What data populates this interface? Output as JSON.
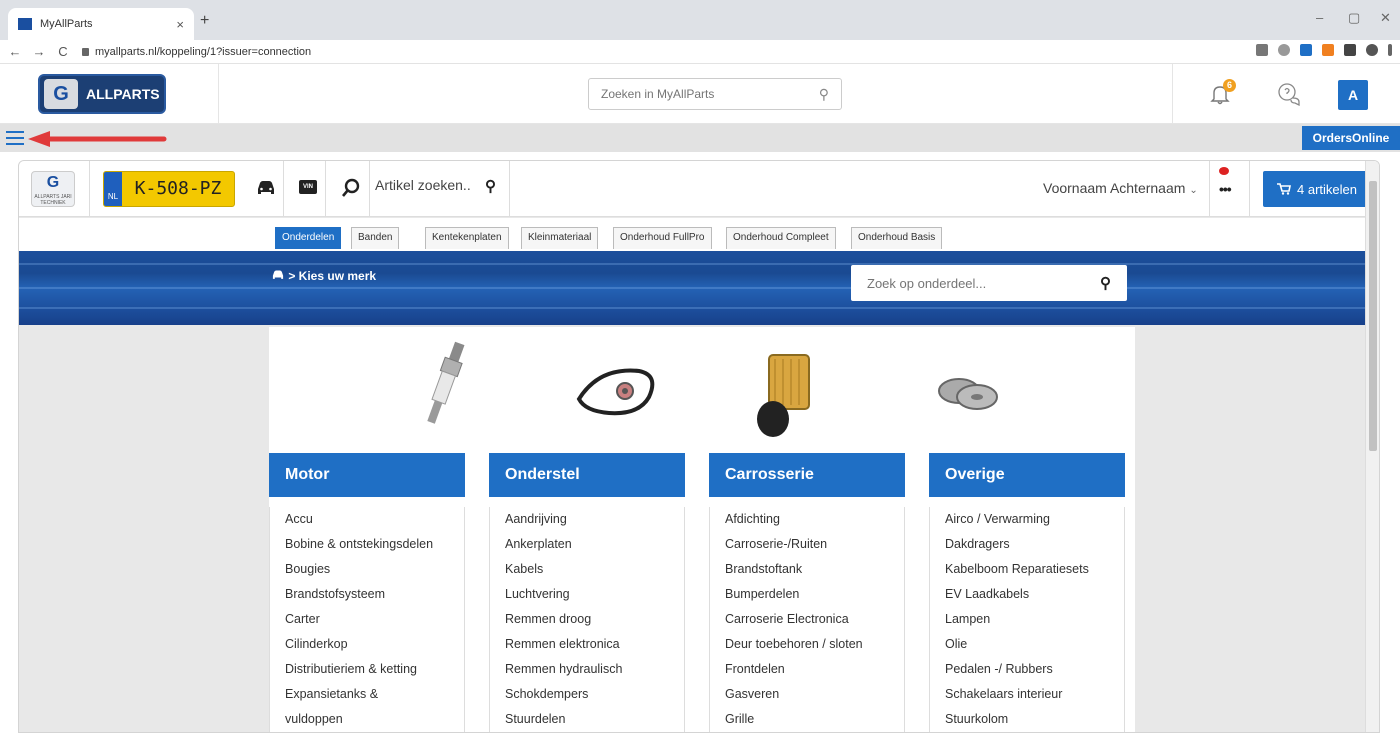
{
  "browser": {
    "tab_title": "MyAllParts",
    "tab_close": "×",
    "new_tab": "+",
    "url": "myallparts.nl/koppeling/1?issuer=connection",
    "back": "←",
    "forward": "→",
    "reload": "C",
    "minimize": "–",
    "maximize": "▢",
    "close": "✕"
  },
  "header": {
    "logo_mark": "G",
    "logo_text": "ALLPARTS",
    "search_placeholder": "Zoeken in MyAllParts",
    "notification_count": "6",
    "avatar_initial": "A"
  },
  "strip": {
    "orders_label": "OrdersOnline"
  },
  "toolbar": {
    "logo_mark": "G",
    "logo_caption": "ALLPARTS JARI TECHNIEK",
    "plate_country": "NL",
    "plate_number": "K-508-PZ",
    "vin_label": "VIN",
    "article_search": "Artikel zoeken..",
    "user_name": "Voornaam Achternaam",
    "user_chevron": "⌄",
    "more": "•••",
    "cart_label": "4 artikelen"
  },
  "category_tabs": [
    "Onderdelen",
    "Banden",
    "Kentekenplaten",
    "Kleinmateriaal",
    "Onderhoud FullPro",
    "Onderhoud Compleet",
    "Onderhoud Basis"
  ],
  "banner": {
    "breadcrumb": "> Kies uw merk",
    "part_search_placeholder": "Zoek op onderdeel..."
  },
  "columns": [
    {
      "title": "Motor",
      "items": [
        "Accu",
        "Bobine & ontstekingsdelen",
        "Bougies",
        "Brandstofsysteem",
        "Carter",
        "Cilinderkop",
        "Distributieriem & ketting",
        "Expansietanks &",
        "vuldoppen"
      ]
    },
    {
      "title": "Onderstel",
      "items": [
        "Aandrijving",
        "Ankerplaten",
        "Kabels",
        "Luchtvering",
        "Remmen droog",
        "Remmen elektronica",
        "Remmen hydraulisch",
        "Schokdempers",
        "Stuurdelen"
      ]
    },
    {
      "title": "Carrosserie",
      "items": [
        "Afdichting",
        "Carroserie-/Ruiten",
        "Brandstoftank",
        "Bumperdelen",
        "Carroserie Electronica",
        "Deur toebehoren / sloten",
        "Frontdelen",
        "Gasveren",
        "Grille"
      ]
    },
    {
      "title": "Overige",
      "items": [
        "Airco / Verwarming",
        "Dakdragers",
        "Kabelboom Reparatiesets",
        "EV Laadkabels",
        "Lampen",
        "Olie",
        "Pedalen -/ Rubbers",
        "Schakelaars interieur",
        "Stuurkolom"
      ]
    }
  ],
  "colors": {
    "accent": "#1f6fc5",
    "plate": "#f3c800",
    "badge": "#f0a020",
    "arrow": "#e03a3a"
  }
}
